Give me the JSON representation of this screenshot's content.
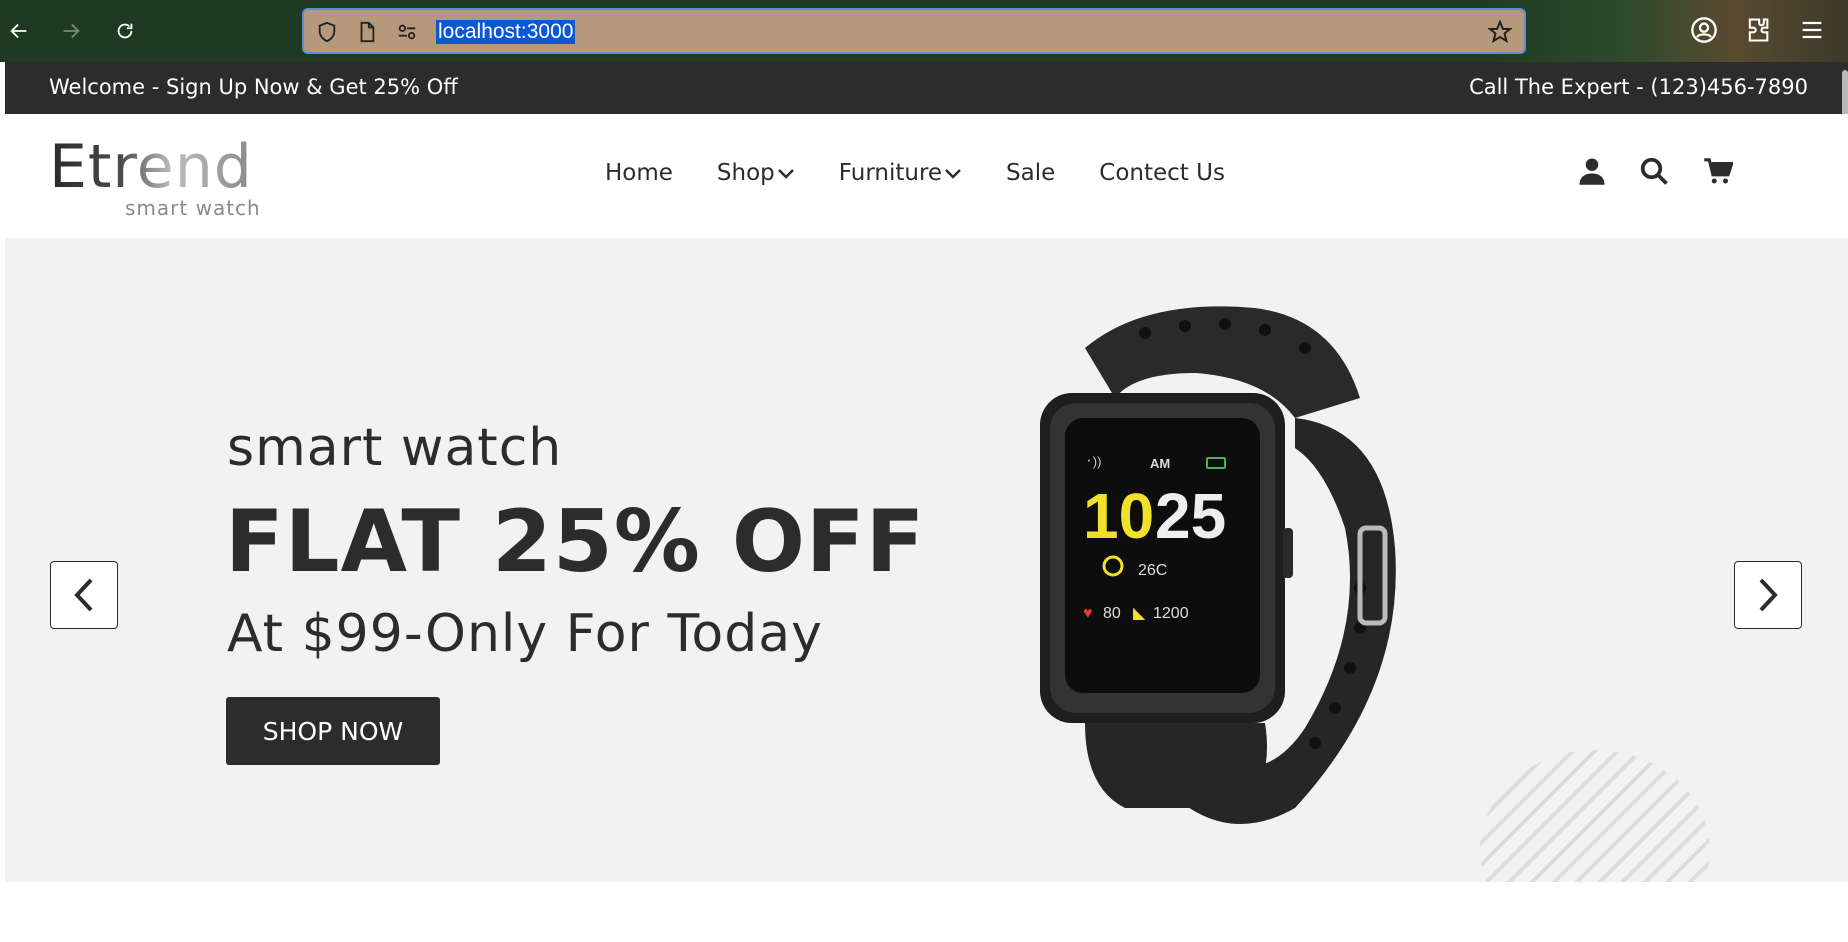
{
  "browser": {
    "url": "localhost:3000"
  },
  "topbar": {
    "welcome": "Welcome - Sign Up Now & Get 25% Off",
    "call": "Call The Expert - (123)456-7890"
  },
  "logo": {
    "main": "Etrend",
    "sub": "smart watch"
  },
  "nav": {
    "home": "Home",
    "shop": "Shop",
    "furniture": "Furniture",
    "sale": "Sale",
    "contact": "Contect Us"
  },
  "hero": {
    "subtitle": "smart watch",
    "headline": "FLAT 25% OFF",
    "tagline": "At $99-Only For Today",
    "button": "SHOP NOW",
    "watch_display": {
      "time_hour": "10",
      "time_min": "25",
      "ampm": "AM",
      "temp": "26C",
      "heart": "80",
      "steps": "1200"
    }
  },
  "icons": {
    "back": "arrow-left-icon",
    "forward": "arrow-right-icon",
    "reload": "reload-icon",
    "user": "user-icon",
    "search": "search-icon",
    "cart": "cart-icon"
  },
  "colors": {
    "dark": "#2c2c2c",
    "hero_bg": "#f2f2f2",
    "url_highlight": "#0a58d6"
  }
}
